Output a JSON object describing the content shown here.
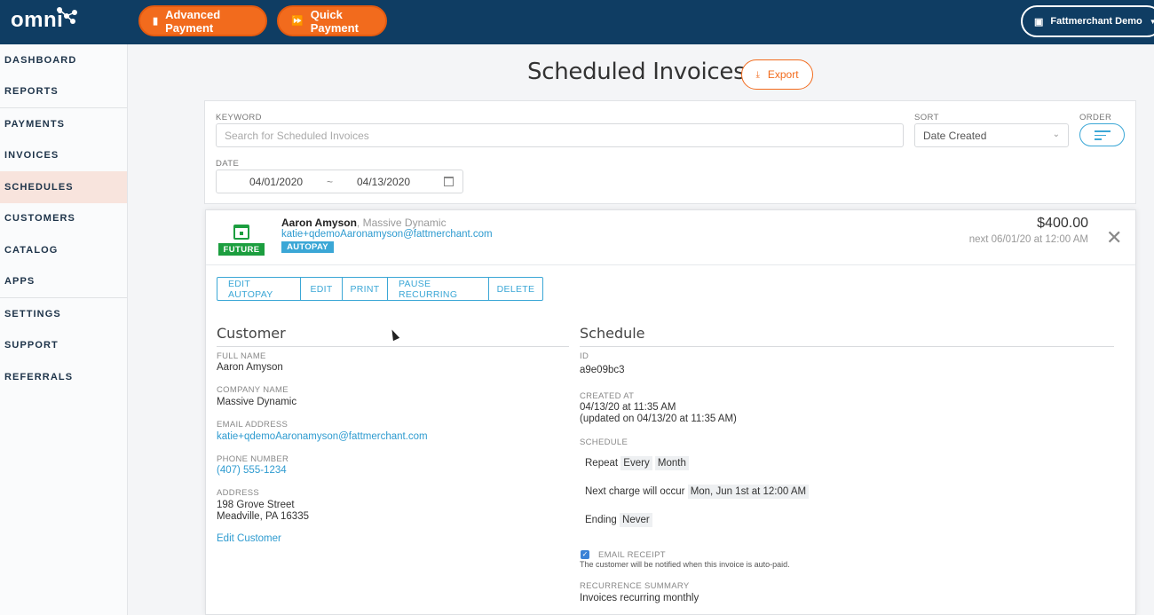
{
  "brand": {
    "logo_text": "omni",
    "accent": "#f26b1d",
    "navy": "#0f3d63",
    "blue": "#3ba7d6",
    "green": "#1c9e3f"
  },
  "topbar": {
    "advanced_payment": "Advanced Payment",
    "quick_payment": "Quick Payment",
    "account": "Fattmerchant Demo"
  },
  "sidebar": {
    "items": [
      {
        "label": "DASHBOARD"
      },
      {
        "label": "REPORTS"
      },
      {
        "label": "PAYMENTS"
      },
      {
        "label": "INVOICES"
      },
      {
        "label": "SCHEDULES",
        "active": true
      },
      {
        "label": "CUSTOMERS"
      },
      {
        "label": "CATALOG"
      },
      {
        "label": "APPS"
      },
      {
        "label": "SETTINGS"
      },
      {
        "label": "SUPPORT"
      },
      {
        "label": "REFERRALS"
      }
    ]
  },
  "page": {
    "title": "Scheduled Invoices",
    "export": "Export"
  },
  "filters": {
    "keyword_label": "KEYWORD",
    "keyword_placeholder": "Search for Scheduled Invoices",
    "sort_label": "SORT",
    "sort_value": "Date Created",
    "order_label": "ORDER",
    "date_label": "DATE",
    "date_from": "04/01/2020",
    "date_sep": "~",
    "date_to": "04/13/2020"
  },
  "invoice": {
    "status": "FUTURE",
    "customer_name": "Aaron Amyson",
    "company_inline": ", Massive Dynamic",
    "email": "katie+qdemoAaronamyson@fattmerchant.com",
    "autopay": "AUTOPAY",
    "amount": "$400.00",
    "next_charge": "next 06/01/20 at 12:00 AM",
    "actions": [
      "EDIT AUTOPAY",
      "EDIT",
      "PRINT",
      "PAUSE RECURRING",
      "DELETE"
    ]
  },
  "customer": {
    "section_title": "Customer",
    "full_name_label": "FULL NAME",
    "full_name": "Aaron Amyson",
    "company_label": "COMPANY NAME",
    "company": "Massive Dynamic",
    "email_label": "EMAIL ADDRESS",
    "email": "katie+qdemoAaronamyson@fattmerchant.com",
    "phone_label": "PHONE NUMBER",
    "phone": "(407) 555-1234",
    "address_label": "ADDRESS",
    "address_line1": "198 Grove Street",
    "address_line2": "Meadville, PA 16335",
    "edit_link": "Edit Customer"
  },
  "schedule": {
    "section_title": "Schedule",
    "id_label": "ID",
    "id": "a9e09bc3",
    "created_label": "CREATED AT",
    "created": "04/13/20 at 11:35 AM",
    "updated": "(updated on 04/13/20 at 11:35 AM)",
    "schedule_label": "SCHEDULE",
    "repeat_text": "Repeat",
    "repeat_every": "Every",
    "repeat_period": "Month",
    "next_text": "Next charge will occur",
    "next_value": "Mon, Jun 1st at 12:00 AM",
    "ending_text": "Ending",
    "ending_value": "Never",
    "email_receipt_label": "EMAIL RECEIPT",
    "email_receipt_note": "The customer will be notified when this invoice is auto-paid.",
    "summary_label": "RECURRENCE SUMMARY",
    "summary": "Invoices recurring monthly"
  }
}
